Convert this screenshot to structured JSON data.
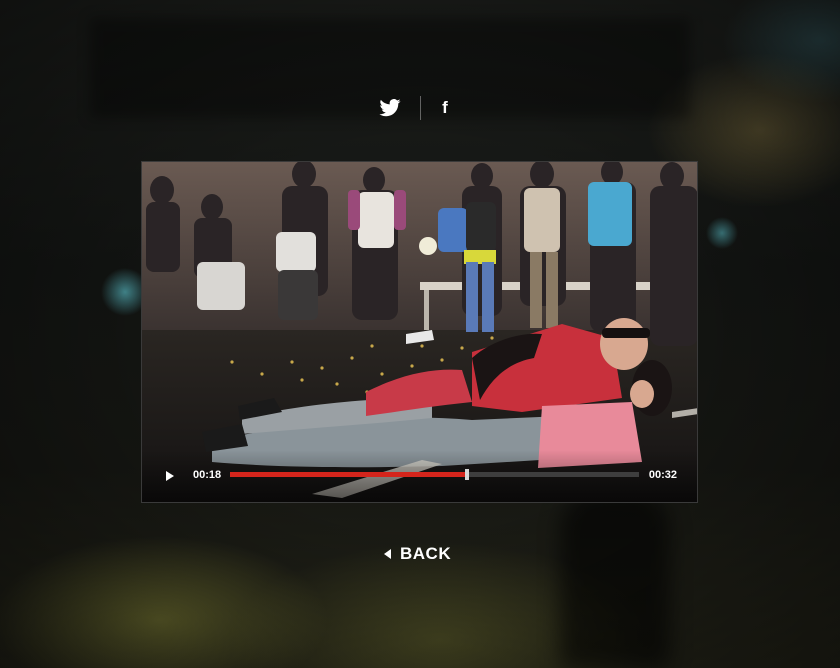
{
  "social": {
    "twitter_icon": "twitter-bird-icon",
    "facebook_label": "f"
  },
  "video": {
    "current_time": "00:18",
    "total_time": "00:32",
    "progress_fraction": 0.58,
    "play_icon": "play-icon",
    "progress_color": "#d4251c"
  },
  "nav": {
    "back_label": "BACK",
    "back_icon": "caret-left-icon"
  }
}
